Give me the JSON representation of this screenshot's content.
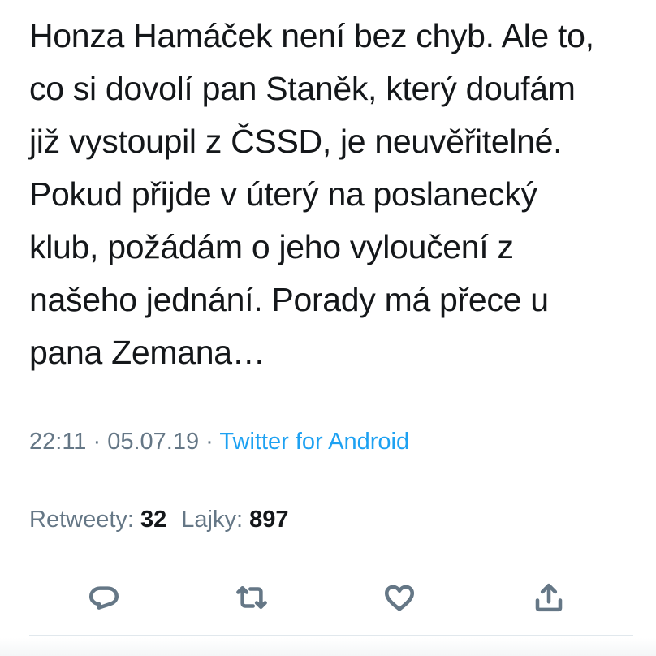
{
  "tweet": {
    "text_lines": [
      "Honza Hamáček není bez chyb. Ale to,",
      "co si dovolí pan Staněk, který doufám",
      "již vystoupil z ČSSD, je neuvěřitelné.",
      "Pokud přijde v úterý na poslanecký",
      "klub, požádám o jeho vyloučení z",
      "našeho jednání. Porady má přece u",
      "pana Zemana…"
    ],
    "time": "22:11",
    "date": "05.07.19",
    "separator": "·",
    "source": "Twitter for Android"
  },
  "stats": {
    "retweets_label": "Retweety:",
    "retweets_count": "32",
    "likes_label": "Lajky:",
    "likes_count": "897"
  },
  "actions": {
    "reply_icon": "reply-icon",
    "retweet_icon": "retweet-icon",
    "like_icon": "heart-icon",
    "share_icon": "share-icon"
  },
  "colors": {
    "text": "#14171a",
    "secondary": "#657786",
    "link": "#1da1f2",
    "divider": "#e1e8ed"
  }
}
